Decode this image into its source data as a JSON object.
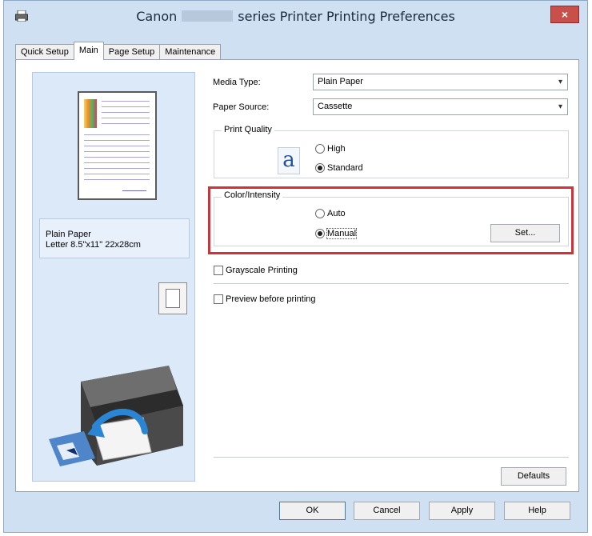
{
  "window": {
    "title_prefix": "Canon",
    "title_suffix": "series Printer Printing Preferences",
    "close_label": "×"
  },
  "tabs": [
    {
      "label": "Quick Setup",
      "active": false
    },
    {
      "label": "Main",
      "active": true
    },
    {
      "label": "Page Setup",
      "active": false
    },
    {
      "label": "Maintenance",
      "active": false
    }
  ],
  "preview": {
    "paper_type": "Plain Paper",
    "paper_size": "Letter 8.5\"x11\" 22x28cm"
  },
  "main": {
    "media_type": {
      "label": "Media Type:",
      "value": "Plain Paper"
    },
    "paper_source": {
      "label": "Paper Source:",
      "value": "Cassette"
    },
    "print_quality": {
      "title": "Print Quality",
      "icon_glyph": "a",
      "options": [
        {
          "label": "High",
          "selected": false
        },
        {
          "label": "Standard",
          "selected": true
        }
      ]
    },
    "color_intensity": {
      "title": "Color/Intensity",
      "options": [
        {
          "label": "Auto",
          "selected": false
        },
        {
          "label": "Manual",
          "selected": true
        }
      ],
      "set_button": "Set..."
    },
    "grayscale_printing": {
      "label": "Grayscale Printing",
      "checked": false
    },
    "preview_before_printing": {
      "label": "Preview before printing",
      "checked": false
    },
    "defaults_button": "Defaults"
  },
  "footer": {
    "ok": "OK",
    "cancel": "Cancel",
    "apply": "Apply",
    "help": "Help"
  },
  "colors": {
    "highlight": "#d3303a",
    "window_bg": "#cfe0f2",
    "close_button": "#c84f4a"
  },
  "icons": [
    "printer-app-icon",
    "close-icon",
    "chevron-down-icon",
    "quality-letter-icon",
    "orientation-portrait-icon",
    "printer-illustration-icon"
  ]
}
